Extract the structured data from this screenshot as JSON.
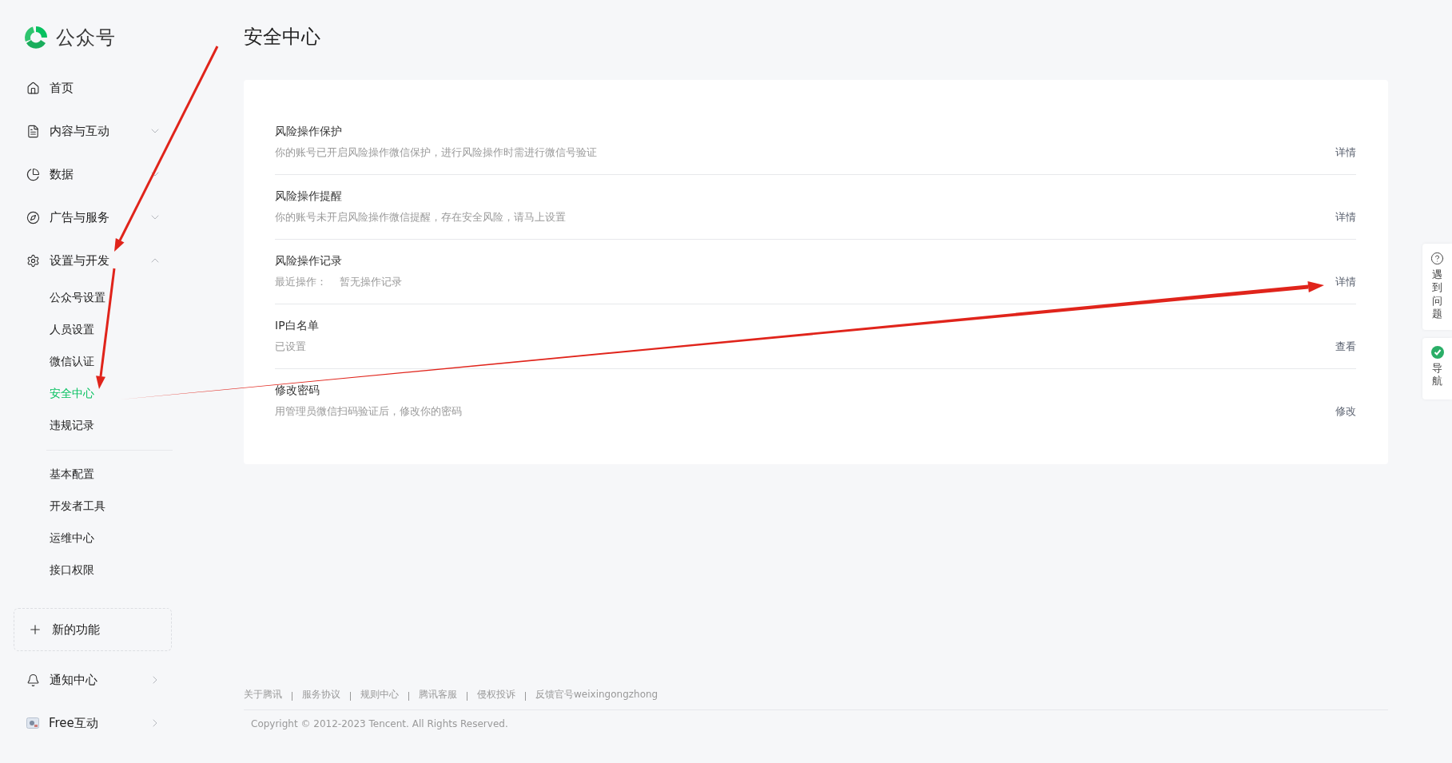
{
  "logo": {
    "title": "公众号"
  },
  "nav": [
    {
      "label": "首页"
    },
    {
      "label": "内容与互动",
      "expanded": false
    },
    {
      "label": "数据",
      "expanded": false
    },
    {
      "label": "广告与服务",
      "expanded": false
    },
    {
      "label": "设置与开发",
      "expanded": true,
      "children_groups": [
        [
          {
            "label": "公众号设置",
            "selected": false
          },
          {
            "label": "人员设置",
            "selected": false
          },
          {
            "label": "微信认证",
            "selected": false
          },
          {
            "label": "安全中心",
            "selected": true
          },
          {
            "label": "违规记录",
            "selected": false
          }
        ],
        [
          {
            "label": "基本配置",
            "selected": false
          },
          {
            "label": "开发者工具",
            "selected": false
          },
          {
            "label": "运维中心",
            "selected": false
          },
          {
            "label": "接口权限",
            "selected": false
          }
        ]
      ]
    }
  ],
  "new_feature": {
    "label": "新的功能"
  },
  "bottom_nav": [
    {
      "label": "通知中心"
    },
    {
      "label": "Free互动"
    }
  ],
  "page_title": "安全中心",
  "security_items": [
    {
      "title": "风险操作保护",
      "description": "你的账号已开启风险操作微信保护，进行风险操作时需进行微信号验证",
      "action": "详情"
    },
    {
      "title": "风险操作提醒",
      "description": "你的账号未开启风险操作微信提醒，存在安全风险，请马上设置",
      "action": "详情"
    },
    {
      "title": "风险操作记录",
      "description": "最近操作：",
      "value": "暂无操作记录",
      "action": "详情"
    },
    {
      "title": "IP白名单",
      "description": "已设置",
      "action": "查看"
    },
    {
      "title": "修改密码",
      "description": "用管理员微信扫码验证后，修改你的密码",
      "action": "修改"
    }
  ],
  "footer": {
    "links": [
      "关于腾讯",
      "服务协议",
      "规则中心",
      "腾讯客服",
      "侵权投诉",
      "反馈官号weixingongzhong"
    ],
    "copyright": "Copyright © 2012-2023 Tencent. All Rights Reserved."
  },
  "side_widget": {
    "help": "遇到问题",
    "guide": "导航"
  }
}
